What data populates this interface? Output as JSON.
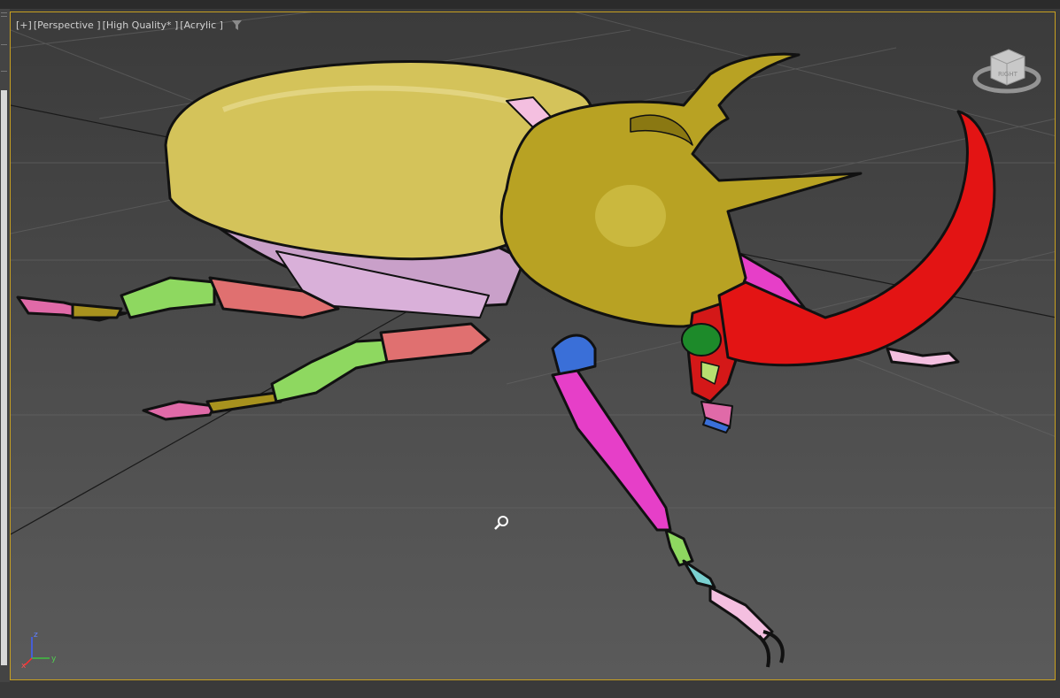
{
  "viewport": {
    "labels": {
      "plus": "[+]",
      "view": "[Perspective ]",
      "shading": "[High Quality* ]",
      "style": "[Acrylic ]"
    },
    "viewcube_face": "RIGHT",
    "axes": {
      "x": "x",
      "y": "y",
      "z": "z"
    }
  },
  "icons": [
    "filter-icon",
    "viewcube-icon",
    "axis-gizmo-icon",
    "zoom-cursor-icon"
  ],
  "colors": {
    "frame": "#c8a020",
    "elytra": "#d4c35a",
    "pronotum": "#b8a223",
    "horn": "#e31414",
    "leg_pink": "#e63fc8",
    "leg_salmon": "#e07070",
    "leg_green": "#8ed860",
    "coxa_blue": "#3a6fd8"
  }
}
